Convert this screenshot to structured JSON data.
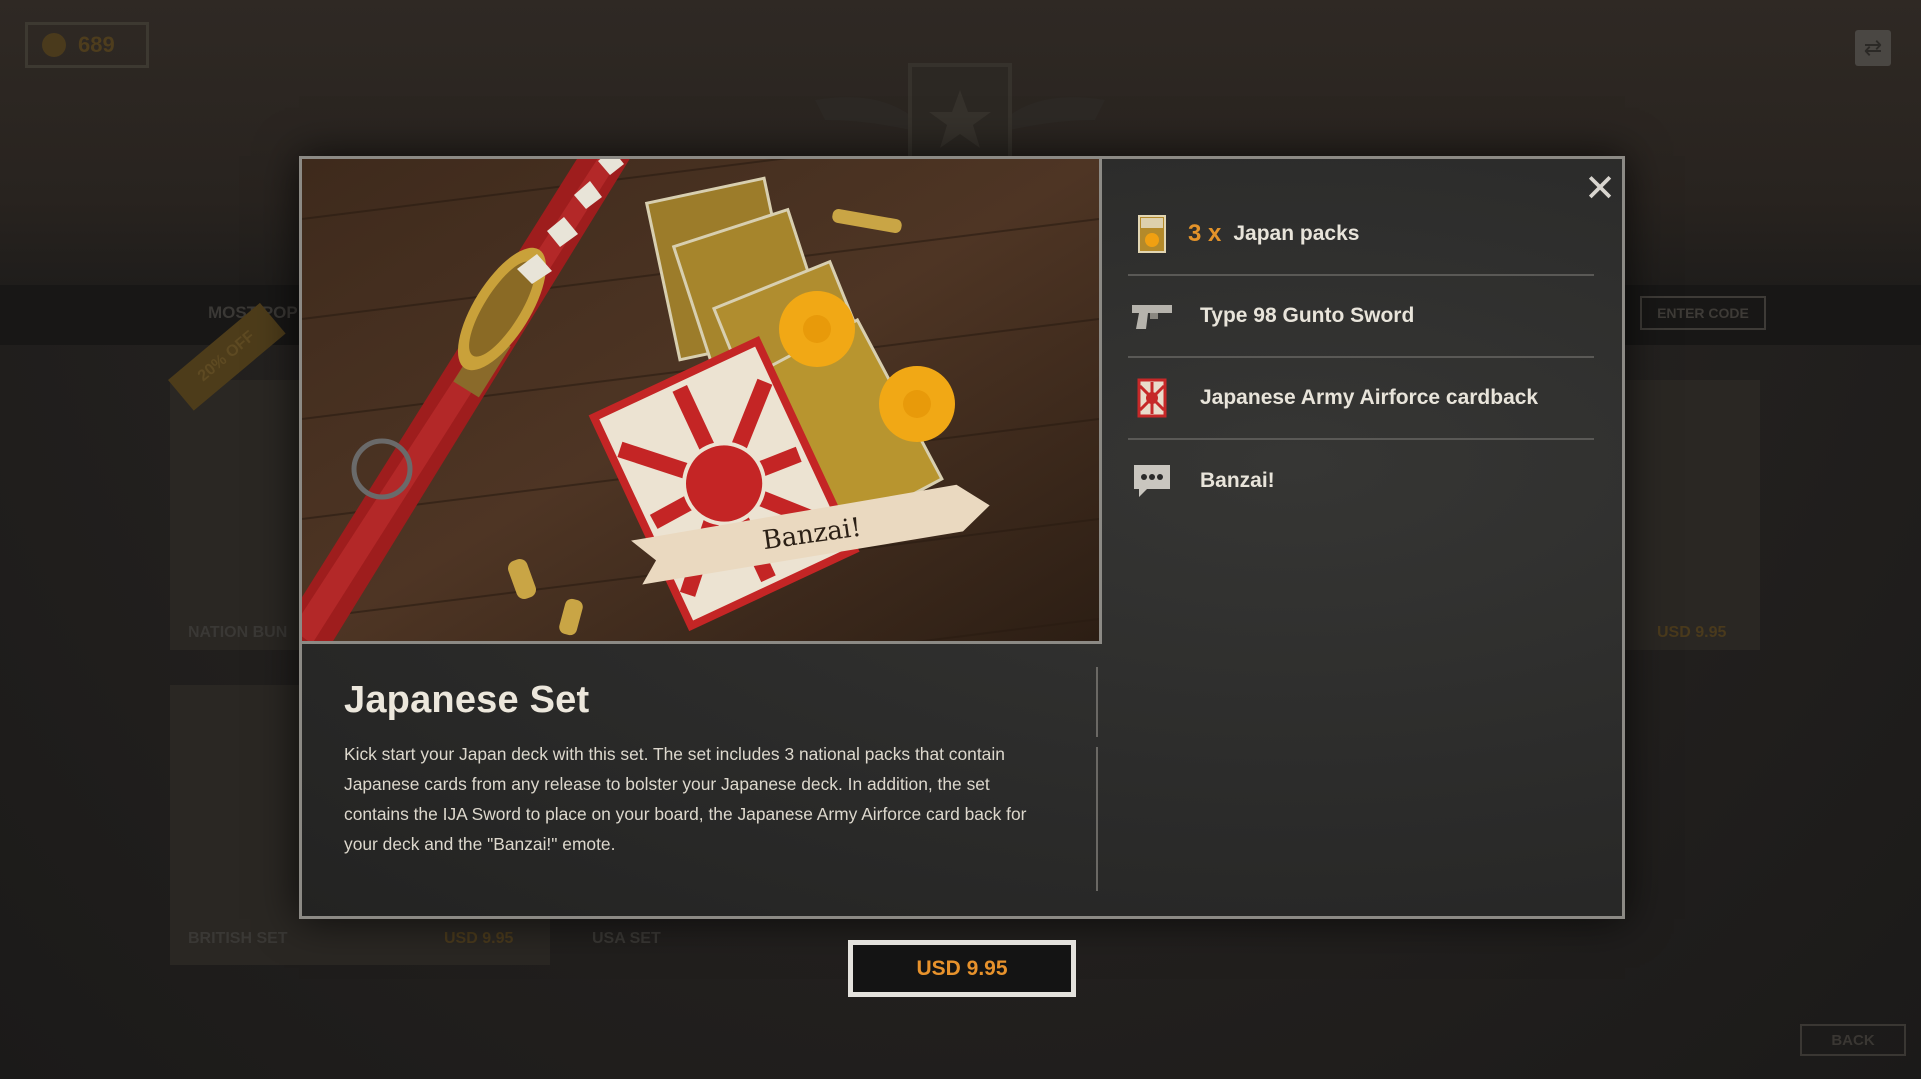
{
  "background": {
    "gold_amount": "689",
    "nav_label": "MOST POP",
    "enter_code_label": "ENTER CODE",
    "discount_ribbon": "20% OFF",
    "cards": [
      {
        "label": "NATION BUN",
        "price": ""
      },
      {
        "label": "",
        "price": "USD 9.95"
      },
      {
        "label": "BRITISH SET",
        "price": "USD 9.95"
      },
      {
        "label": "USA SET",
        "price": ""
      }
    ],
    "back_label": "BACK"
  },
  "modal": {
    "hero_banner_text": "Banzai!",
    "close_icon": "close-icon",
    "items": [
      {
        "icon": "card-pack-icon",
        "quantity": "3 x",
        "label": "Japan packs"
      },
      {
        "icon": "pistol-icon",
        "quantity": "",
        "label": "Type 98 Gunto Sword"
      },
      {
        "icon": "cardback-icon",
        "quantity": "",
        "label": "Japanese Army Airforce cardback"
      },
      {
        "icon": "speech-bubble-icon",
        "quantity": "",
        "label": "Banzai!"
      }
    ],
    "title": "Japanese Set",
    "description": "Kick start your Japan deck with this set. The set includes 3 national packs that contain Japanese cards from any release to bolster your Japanese deck. In addition, the set contains the IJA Sword to place on your board, the Japanese Army Airforce card back for your deck and the \"Banzai!\" emote.",
    "price_label": "USD 9.95"
  },
  "colors": {
    "accent_orange": "#e3932a",
    "frame_border": "#8c8a85"
  }
}
